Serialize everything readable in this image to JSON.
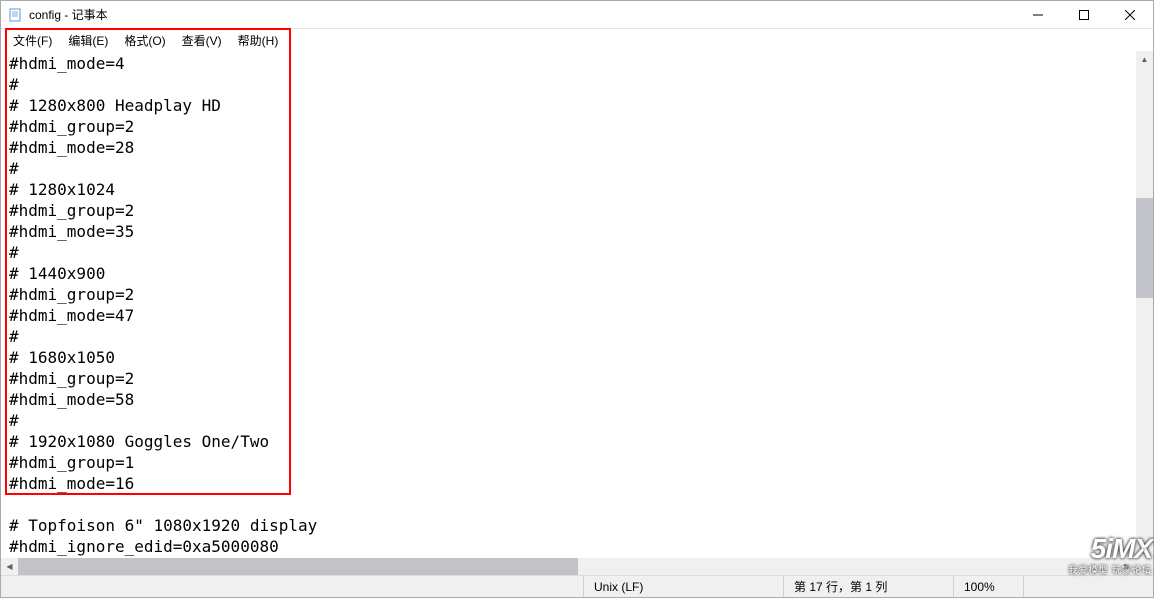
{
  "window": {
    "title": "config - 记事本"
  },
  "menu": {
    "file": "文件(F)",
    "edit": "编辑(E)",
    "format": "格式(O)",
    "view": "查看(V)",
    "help": "帮助(H)"
  },
  "content": "#hdmi_mode=4\n#\n# 1280x800 Headplay HD\n#hdmi_group=2\n#hdmi_mode=28\n#\n# 1280x1024\n#hdmi_group=2\n#hdmi_mode=35\n#\n# 1440x900\n#hdmi_group=2\n#hdmi_mode=47\n#\n# 1680x1050\n#hdmi_group=2\n#hdmi_mode=58\n#\n# 1920x1080 Goggles One/Two\n#hdmi_group=1\n#hdmi_mode=16\n\n# Topfoison 6\" 1080x1920 display\n#hdmi_ignore_edid=0xa5000080",
  "statusbar": {
    "encoding_type": "Unix (LF)",
    "position": "第 17 行，第 1 列",
    "zoom": "100%"
  },
  "watermark": {
    "logo": "5iMX",
    "tagline": "我爱模型 玩家论坛"
  },
  "bg_hints": {
    "h1": "见",
    "h2": "g",
    "h3": "F",
    "h4": "刂",
    "h5": "文"
  }
}
